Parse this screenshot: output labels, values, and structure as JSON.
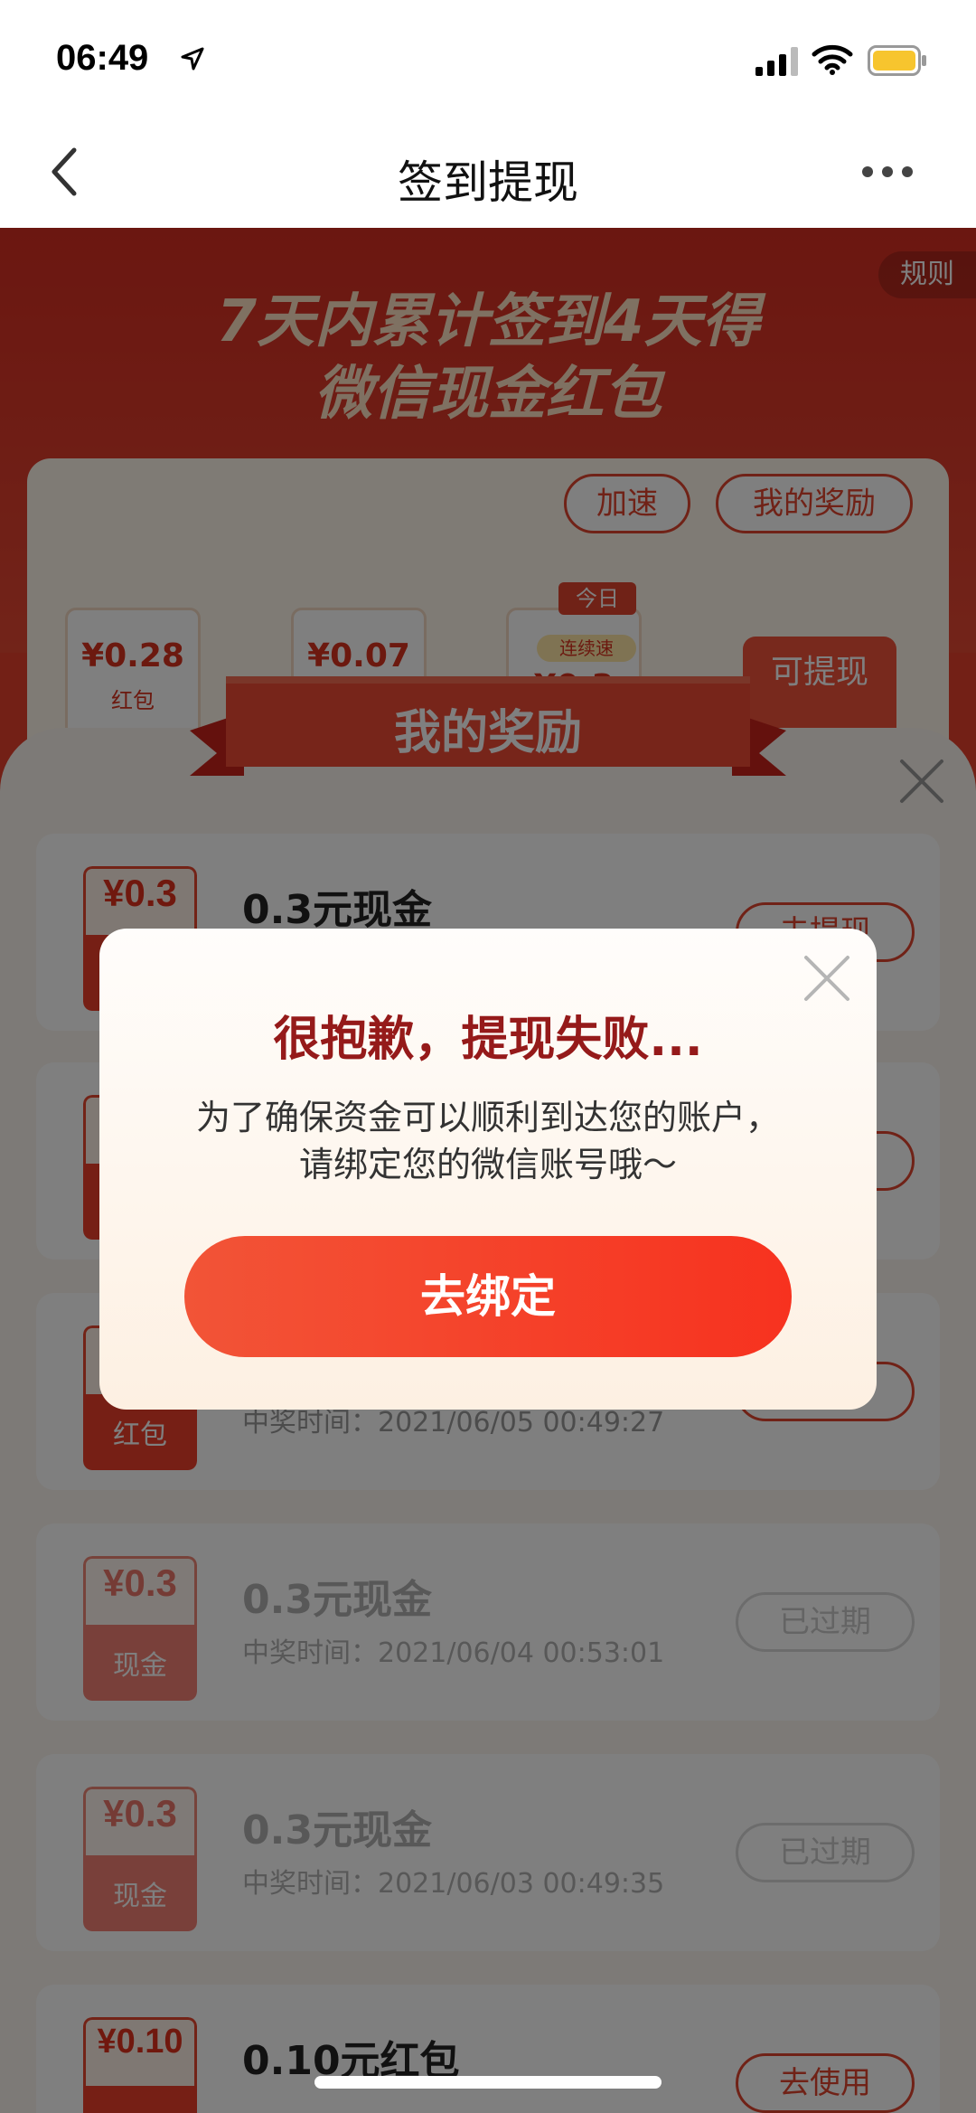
{
  "status_bar": {
    "time": "06:49"
  },
  "nav": {
    "title": "签到提现"
  },
  "banner": {
    "line1": "7天内累计签到4天得",
    "line2": "微信现金红包",
    "rules_label": "规则"
  },
  "checkin": {
    "speed_label": "加速",
    "my_reward_label": "我的奖励",
    "today_label": "今日",
    "speed_tag": "连续速",
    "withdraw_label": "可提现",
    "days": [
      {
        "value": "¥0.28",
        "sub": "红包"
      },
      {
        "value": "¥0.07",
        "sub": ""
      },
      {
        "value": "¥0.3",
        "sub": ""
      }
    ]
  },
  "reward_panel": {
    "title": "我的奖励",
    "items": [
      {
        "coupon_value": "¥0.3",
        "coupon_type": "",
        "title": "0.3元现金",
        "time": "",
        "button": "去提现",
        "state": "active"
      },
      {
        "coupon_value": "",
        "coupon_type": "",
        "title": "",
        "time": "",
        "button": "",
        "state": "active"
      },
      {
        "coupon_value": "",
        "coupon_type": "红包",
        "title": "",
        "time": "中奖时间：2021/06/05 00:49:27",
        "button": "",
        "state": "active"
      },
      {
        "coupon_value": "¥0.3",
        "coupon_type": "现金",
        "title": "0.3元现金",
        "time": "中奖时间：2021/06/04 00:53:01",
        "button": "已过期",
        "state": "expired"
      },
      {
        "coupon_value": "¥0.3",
        "coupon_type": "现金",
        "title": "0.3元现金",
        "time": "中奖时间：2021/06/03 00:49:35",
        "button": "已过期",
        "state": "expired"
      },
      {
        "coupon_value": "¥0.10",
        "coupon_type": "",
        "title": "0.10元红包",
        "time": "",
        "button": "去使用",
        "state": "active"
      }
    ]
  },
  "dialog": {
    "title": "很抱歉，提现失败...",
    "message_line1": "为了确保资金可以顺利到达您的账户，",
    "message_line2": "请绑定您的微信账号哦～",
    "button_label": "去绑定"
  },
  "colors": {
    "accent": "#e0452f",
    "dialog_title": "#951a1a",
    "button_red": "#f7321f"
  }
}
